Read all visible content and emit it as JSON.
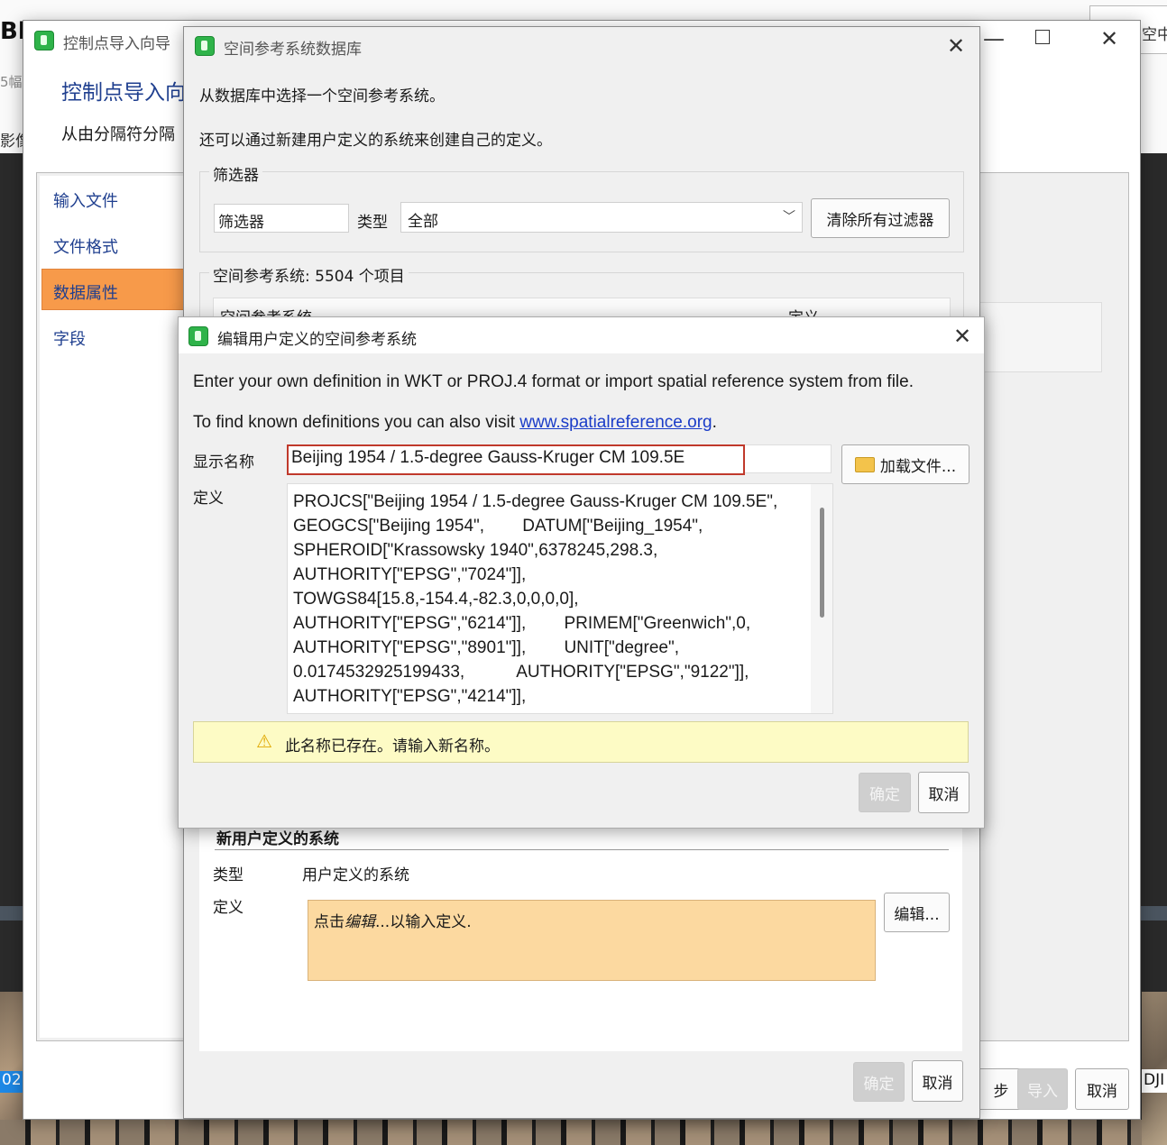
{
  "background": {
    "top_left_text": "Bl",
    "left_text_1": "5幅",
    "left_text_2": "影像",
    "top_right_text": "空中",
    "bottom_left_number": "02",
    "bottom_right_text": "DJI",
    "right_arrow": "≡"
  },
  "wizard": {
    "title": "控制点导入向导",
    "heading": "控制点导入向",
    "subheading": "从由分隔符分隔",
    "nav": [
      "输入文件",
      "文件格式",
      "数据属性",
      "字段"
    ],
    "active_nav_index": 2,
    "next_label": "步",
    "import_label": "导入",
    "cancel_label": "取消"
  },
  "srs_db": {
    "title": "空间参考系统数据库",
    "intro_1": "从数据库中选择一个空间参考系统。",
    "intro_2": "还可以通过新建用户定义的系统来创建自己的定义。",
    "filter_group": "筛选器",
    "filter_placeholder": "筛选器",
    "type_label": "类型",
    "type_value": "全部",
    "clear_filters": "清除所有过滤器",
    "list_header": "空间参考系统: 5504 个项目",
    "col_srs": "空间参考系统",
    "col_def": "定义",
    "new_user_system": "新用户定义的系统",
    "type_row_label": "类型",
    "type_row_value": "用户定义的系统",
    "def_row_label": "定义",
    "def_hint_prefix": "点击",
    "def_hint_italic": "编辑",
    "def_hint_suffix": "...以输入定义.",
    "edit_button": "编辑...",
    "ok": "确定",
    "cancel": "取消"
  },
  "edit_dialog": {
    "title": "编辑用户定义的空间参考系统",
    "desc": "Enter your own definition in WKT or PROJ.4 format or import spatial reference system from file.",
    "find_prefix": "To find known definitions you can also visit ",
    "find_link": "www.spatialreference.org",
    "find_suffix": ".",
    "name_label": "显示名称",
    "name_value": "Beijing 1954 / 1.5-degree Gauss-Kruger CM 109.5E",
    "load_file": "加载文件...",
    "def_label": "定义",
    "definition_lines": [
      "PROJCS[\"Beijing 1954 / 1.5-degree Gauss-Kruger CM 109.5E\",",
      "GEOGCS[\"Beijing 1954\",        DATUM[\"Beijing_1954\",",
      "SPHEROID[\"Krassowsky 1940\",6378245,298.3,",
      "AUTHORITY[\"EPSG\",\"7024\"]],",
      "TOWGS84[15.8,-154.4,-82.3,0,0,0,0],",
      "AUTHORITY[\"EPSG\",\"6214\"]],        PRIMEM[\"Greenwich\",0,",
      "AUTHORITY[\"EPSG\",\"8901\"]],        UNIT[\"degree\",",
      "0.0174532925199433,           AUTHORITY[\"EPSG\",\"9122\"]],",
      "AUTHORITY[\"EPSG\",\"4214\"]],"
    ],
    "warning": "此名称已存在。请输入新名称。",
    "ok": "确定",
    "cancel": "取消"
  },
  "colors": {
    "accent_orange": "#f79a4a",
    "warning_bg": "#fdfbc5",
    "name_border": "#c0392b",
    "hint_bg": "#fcd9a0",
    "link": "#1a3cc8"
  }
}
